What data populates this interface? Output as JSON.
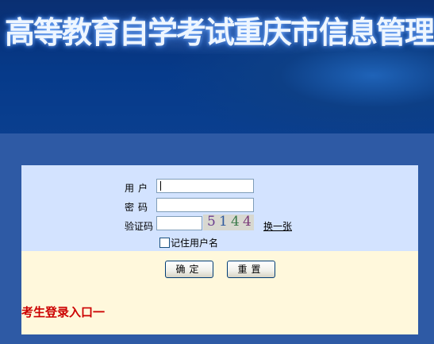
{
  "banner": {
    "title": "高等教育自学考试重庆市信息管理系统"
  },
  "login_form": {
    "username_label": "用户",
    "password_label": "密码",
    "captcha_label": "验证码",
    "username_value": "",
    "password_value": "",
    "captcha_value": "",
    "captcha_digits": [
      "5",
      "1",
      "4",
      "4"
    ],
    "captcha_colors": [
      "#6a3d8f",
      "#2e5a9e",
      "#3a7a4a",
      "#7a3a7a"
    ],
    "change_captcha_label": "换一张",
    "remember_label": "记住用户名",
    "confirm_label": "确定",
    "reset_label": "重置"
  },
  "entry": {
    "label": "考生登录入口一"
  },
  "colors": {
    "page_bg": "#2e5aa5",
    "form_bg": "#d3e3ff",
    "panel_bg": "#fff8dc",
    "entry_link": "#cc0000"
  }
}
